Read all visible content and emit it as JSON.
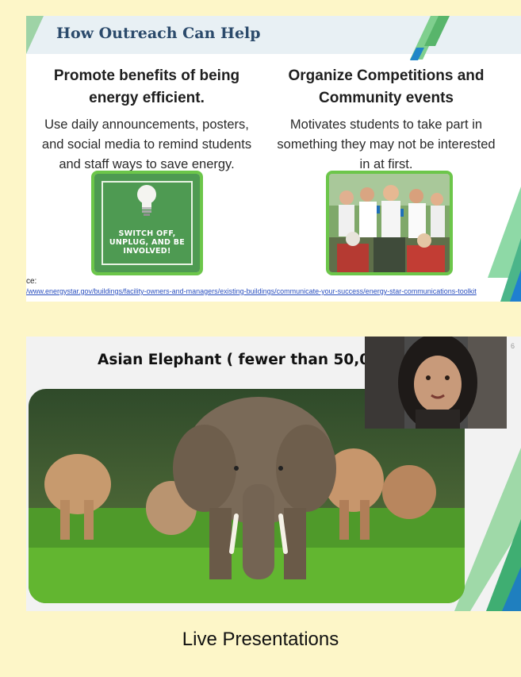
{
  "slide1": {
    "title": "How Outreach Can Help",
    "left": {
      "heading_line1": "Promote benefits of being",
      "heading_line2": "energy efficient.",
      "body_line1": "Use daily announcements, posters,",
      "body_line2": "and social media to remind students",
      "body_line3": "and staff ways to save energy.",
      "poster_line1": "SWITCH OFF,",
      "poster_line2": "UNPLUG, AND BE",
      "poster_line3": "INVOLVED!"
    },
    "right": {
      "heading_line1": "Organize Competitions and",
      "heading_line2": "Community events",
      "body_line1": "Motivates students to take part in",
      "body_line2": "something they may not be interested",
      "body_line3": "in at first."
    },
    "source_label": "ce:",
    "source_link": "/www.energystar.gov/buildings/facility-owners-and-managers/existing-buildings/communicate-your-success/energy-star-communications-toolkit",
    "colors": {
      "accent_green": "#6cc64a",
      "title_blue": "#2b4a6b",
      "link_blue": "#2a4fbf"
    }
  },
  "slide2": {
    "title": "Asian Elephant ( fewer than 50,000)",
    "slide_number": "6"
  },
  "caption": "Live Presentations"
}
